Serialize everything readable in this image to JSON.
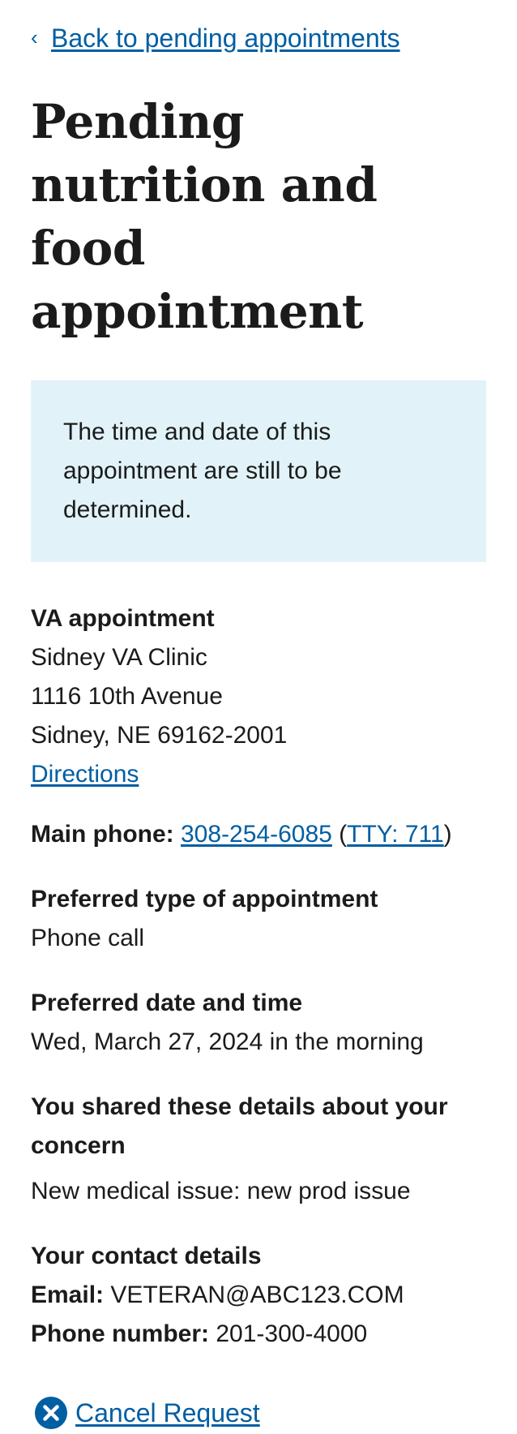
{
  "nav": {
    "back_label": "Back to pending appointments"
  },
  "page": {
    "title": "Pending nutrition and food appointment"
  },
  "alert": {
    "text": "The time and date of this appointment are still to be determined."
  },
  "facility": {
    "heading": "VA appointment",
    "name": "Sidney VA Clinic",
    "street": "1116 10th Avenue",
    "city_state_zip": "Sidney, NE 69162-2001",
    "directions_label": "Directions"
  },
  "phone": {
    "label": "Main phone:",
    "number": "308-254-6085",
    "tty": "TTY: 711"
  },
  "appointment_type": {
    "heading": "Preferred type of appointment",
    "value": "Phone call"
  },
  "preferred_date": {
    "heading": "Preferred date and time",
    "value": "Wed, March 27, 2024 in the morning"
  },
  "concern": {
    "heading": "You shared these details about your concern",
    "value": "New medical issue: new prod issue"
  },
  "contact": {
    "heading": "Your contact details",
    "email_label": "Email:",
    "email": "VETERAN@ABC123.COM",
    "phone_label": "Phone number:",
    "phone": "201-300-4000"
  },
  "actions": {
    "cancel_label": "Cancel Request"
  },
  "colors": {
    "link": "#005ea2",
    "alert_background": "#e1f3f8",
    "text": "#1b1b1b"
  },
  "icons": {
    "back": "chevron-left-icon",
    "cancel": "cancel-circle-icon"
  }
}
